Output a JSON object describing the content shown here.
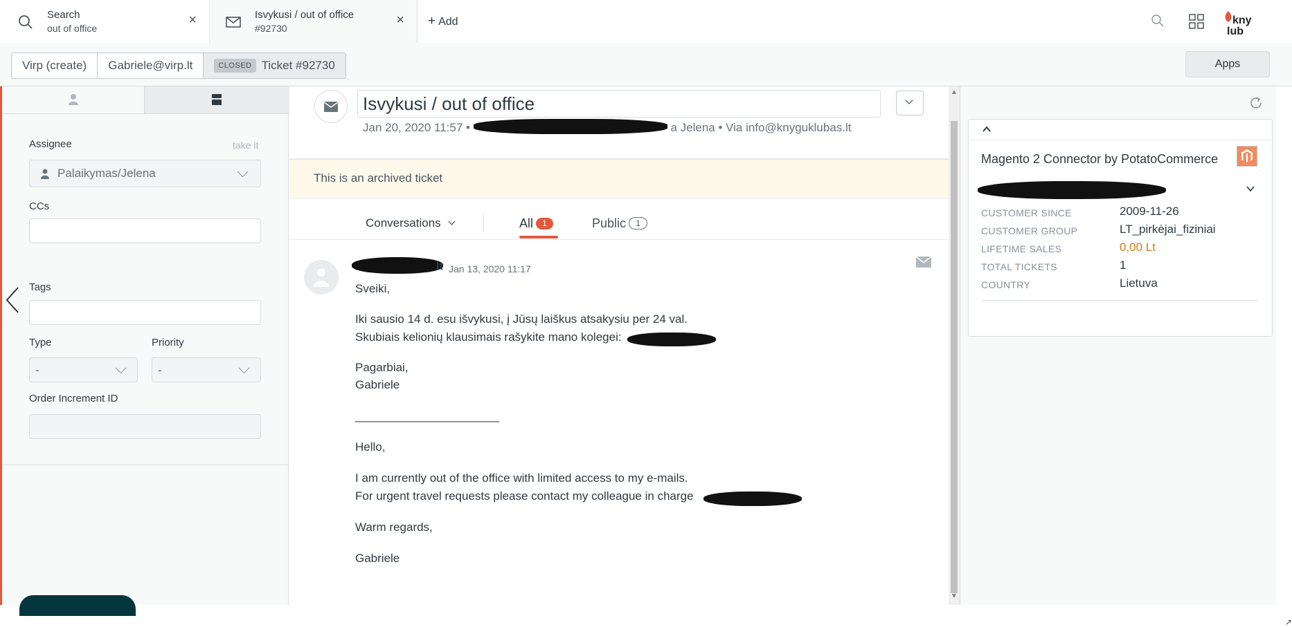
{
  "tabs": [
    {
      "title": "Search",
      "subtitle": "out of office"
    },
    {
      "title": "Isvykusi / out of office",
      "subtitle": "#92730"
    }
  ],
  "add_label": "Add",
  "breadcrumbs": {
    "org": "Virp (create)",
    "requester": "Gabriele@virp.lt",
    "status_badge": "CLOSED",
    "ticket": "Ticket #92730"
  },
  "apps_label": "Apps",
  "left": {
    "assignee_label": "Assignee",
    "take_it": "take it",
    "assignee_value": "Palaikymas/Jelena",
    "ccs_label": "CCs",
    "tags_label": "Tags",
    "type_label": "Type",
    "type_value": "-",
    "priority_label": "Priority",
    "priority_value": "-",
    "order_label": "Order Increment ID"
  },
  "ticket": {
    "subject": "Isvykusi / out of office",
    "meta_date": "Jan 20, 2020 11:57 •",
    "meta_assignee": "a Jelena • Via info@knyguklubas.lt",
    "archived_notice": "This is an archived ticket",
    "conversations_label": "Conversations",
    "tab_all": "All",
    "tab_all_count": "1",
    "tab_public": "Public",
    "tab_public_count": "1"
  },
  "message": {
    "sender_suffix": "lt",
    "time": "Jan 13, 2020 11:17",
    "lines": [
      "Sveiki,",
      "Iki sausio 14 d. esu išvykusi, į Jūsų laiškus atsakysiu per 24 val.",
      "Skubiais kelionių klausimais rašykite mano kolegei:",
      "Pagarbiai,",
      "Gabriele",
      "______________________",
      "Hello,",
      "I am currently out of the office with limited access to my e-mails.",
      "For urgent travel requests please contact my colleague in charge",
      "Warm regards,",
      "Gabriele"
    ]
  },
  "app": {
    "title": "Magento 2 Connector by PotatoCommerce",
    "rows": [
      {
        "key": "CUSTOMER SINCE",
        "value": "2009-11-26"
      },
      {
        "key": "CUSTOMER GROUP",
        "value": "LT_pirkėjai_fiziniai"
      },
      {
        "key": "LIFETIME SALES",
        "value": "0,00 Lt"
      },
      {
        "key": "TOTAL TICKETS",
        "value": "1"
      },
      {
        "key": "COUNTRY",
        "value": "Lietuva"
      }
    ],
    "sales_color": "#d97b12"
  },
  "colors": {
    "accent": "#e05a3e",
    "dark_green": "#03363d",
    "archived_bg": "#fff9ec"
  }
}
